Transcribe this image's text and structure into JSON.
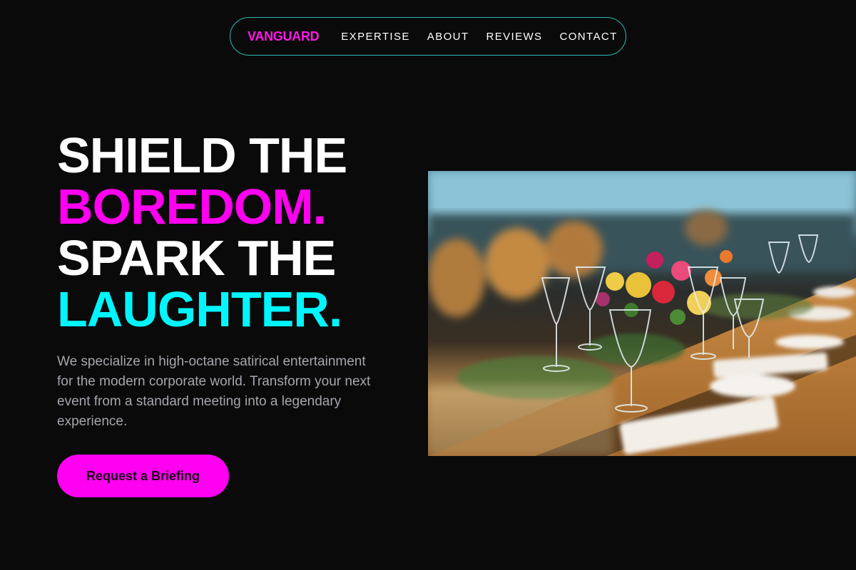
{
  "nav": {
    "brand": "VANGUARD",
    "links": [
      "EXPERTISE",
      "ABOUT",
      "REVIEWS",
      "CONTACT"
    ]
  },
  "hero": {
    "line1": "SHIELD THE",
    "line2": "BOREDOM.",
    "line3": "SPARK THE",
    "line4": "LAUGHTER.",
    "description": "We specialize in high-octane satirical entertainment for the modern corporate world. Transform your next event from a standard meeting into a legendary experience.",
    "cta_label": "Request a Briefing"
  },
  "colors": {
    "background": "#0a0a0a",
    "accent_magenta": "#ff00f0",
    "accent_cyan": "#00f5ff",
    "nav_border": "#2fb8b4"
  },
  "image": {
    "semantic": "banquet-table-photo"
  }
}
